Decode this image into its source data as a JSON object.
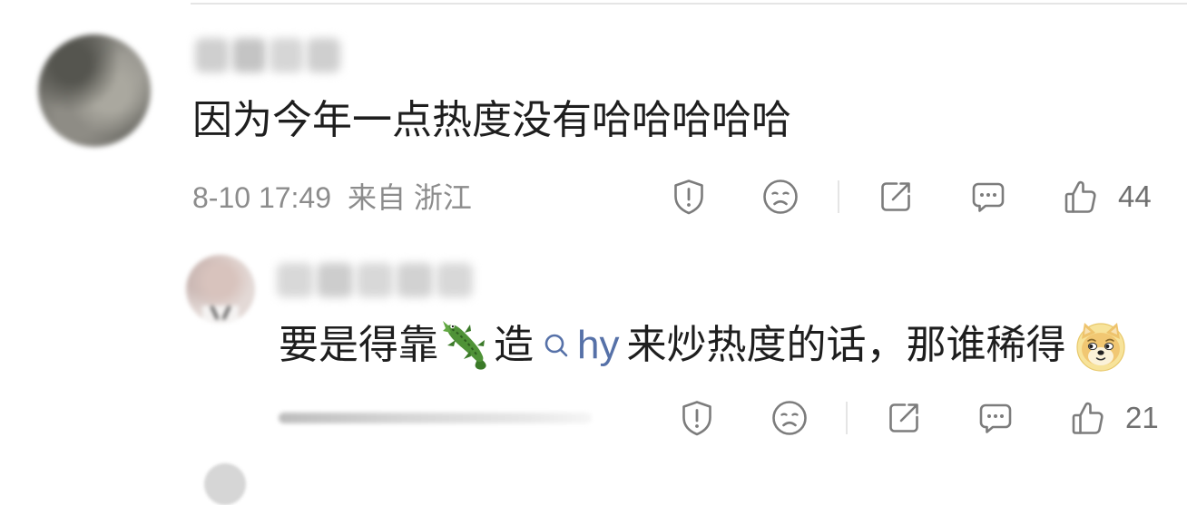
{
  "colors": {
    "text": "#1e1e1e",
    "meta": "#8c8c8c",
    "icon": "#7c7c7c",
    "count": "#707070",
    "link": "#5671a8",
    "divider": "#e5e5e5"
  },
  "comments": [
    {
      "text": "因为今年一点热度没有哈哈哈哈哈",
      "time": "8-10 17:49",
      "location": "来自 浙江",
      "actions": {
        "report_icon": "report-icon",
        "dislike_icon": "frown-icon",
        "share_icon": "share-icon",
        "reply_icon": "comment-icon",
        "like_icon": "thumbs-up-icon",
        "like_count": "44"
      }
    },
    {
      "text_segments": {
        "part1": "要是得靠",
        "emoji1": "crocodile-icon",
        "part2": "造",
        "topic_icon": "search-icon",
        "topic_text": "hy",
        "part3": "来炒热度的话，那谁稀得",
        "emoji2": "doge-icon"
      },
      "actions": {
        "report_icon": "report-icon",
        "dislike_icon": "frown-icon",
        "share_icon": "share-icon",
        "reply_icon": "comment-icon",
        "like_icon": "thumbs-up-icon",
        "like_count": "21"
      }
    }
  ]
}
